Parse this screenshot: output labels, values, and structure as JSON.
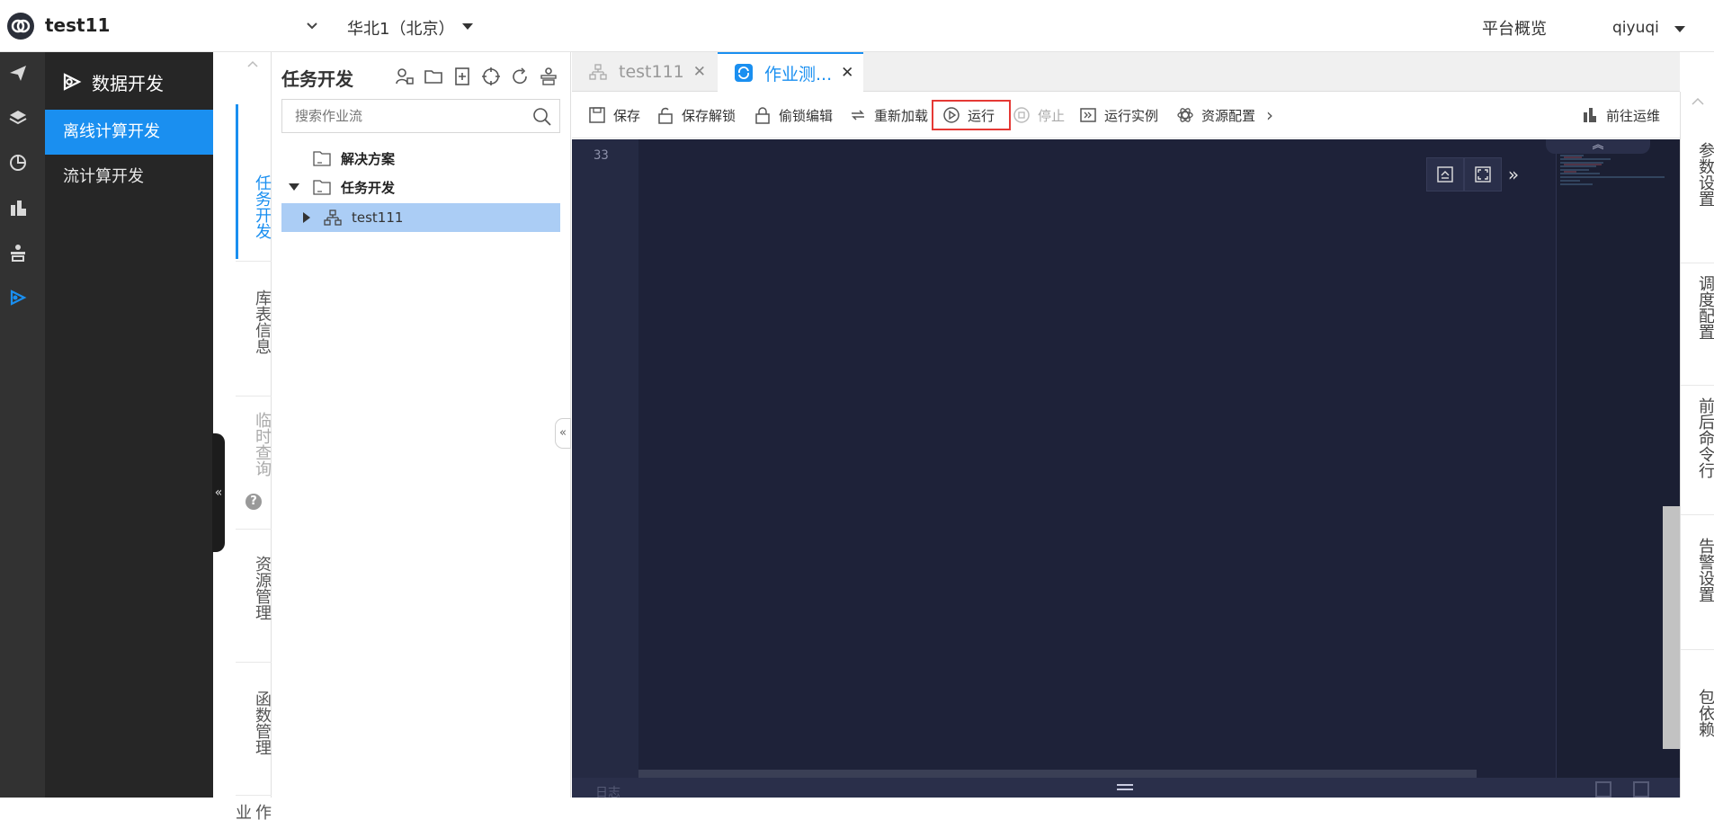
{
  "header": {
    "app_title": "test11",
    "region": "华北1（北京）",
    "overview_link": "平台概览",
    "username": "qiyuqi"
  },
  "sidebar": {
    "section_title": "数据开发",
    "items": [
      {
        "label": "离线计算开发",
        "active": true
      },
      {
        "label": "流计算开发",
        "active": false
      }
    ],
    "rail_icons": [
      "send-icon",
      "layers-icon",
      "pie-chart-icon",
      "data-analysis-icon",
      "ops-icon",
      "data-dev-icon"
    ]
  },
  "vertical_tabs": [
    {
      "label": "任务开发",
      "state": "active"
    },
    {
      "label": "库表信息",
      "state": "normal"
    },
    {
      "label": "临时查询",
      "state": "disabled"
    },
    {
      "label": "资源管理",
      "state": "normal"
    },
    {
      "label": "函数管理",
      "state": "normal"
    },
    {
      "label": "作业",
      "state": "normal"
    }
  ],
  "tree_panel": {
    "title": "任务开发",
    "search_placeholder": "搜索作业流",
    "nodes": [
      {
        "label": "解决方案",
        "level": 0,
        "expanded": null
      },
      {
        "label": "任务开发",
        "level": 0,
        "expanded": true
      },
      {
        "label": "test111",
        "level": 1,
        "expanded": false,
        "selected": true
      }
    ]
  },
  "tabs": [
    {
      "label": "test111",
      "active": false
    },
    {
      "label": "作业测...",
      "active": true
    }
  ],
  "toolbar": {
    "save": "保存",
    "save_unlock": "保存解锁",
    "steal_lock": "偷锁编辑",
    "reload": "重新加载",
    "run": "运行",
    "stop": "停止",
    "run_instance": "运行实例",
    "resource_config": "资源配置",
    "goto_ops": "前往运维"
  },
  "editor": {
    "line_number": "33",
    "bottom_label": "日志"
  },
  "right_panel": [
    {
      "label": "参数设置"
    },
    {
      "label": "调度配置"
    },
    {
      "label": "前后命令行"
    },
    {
      "label": "告警设置"
    },
    {
      "label": "包依赖"
    }
  ],
  "colors": {
    "accent": "#1a8ff0",
    "run_highlight": "#e53935",
    "editor_bg": "#1e2239",
    "sidebar_bg": "#262626"
  }
}
